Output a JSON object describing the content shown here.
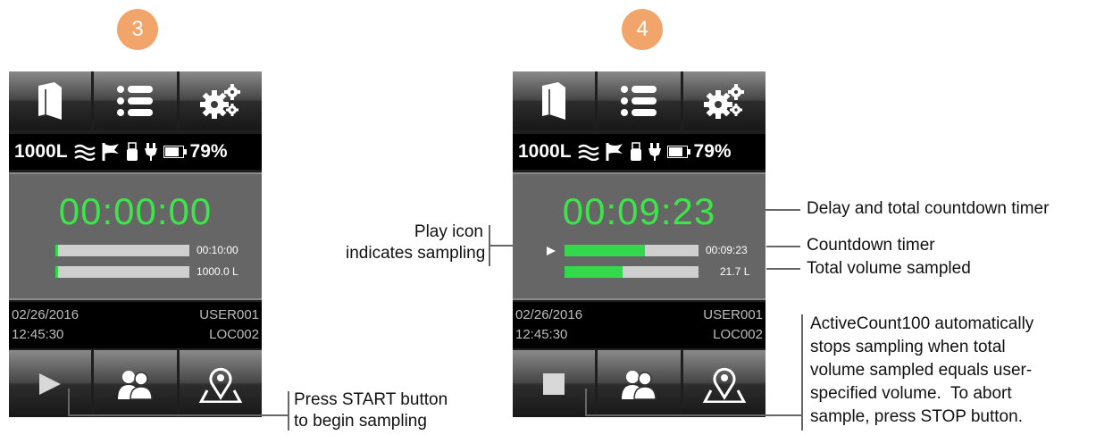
{
  "steps": [
    {
      "number": "3",
      "status": {
        "volume": "1000L",
        "battery": "79%"
      },
      "timer": "00:00:00",
      "bars": [
        {
          "value": "00:10:00",
          "fill": 0.02
        },
        {
          "value": "1000.0 L",
          "fill": 0.02
        }
      ],
      "sampling": false,
      "info": {
        "date": "02/26/2016",
        "time": "12:45:30",
        "user": "USER001",
        "location": "LOC002"
      },
      "start_stop_icon": "play-icon"
    },
    {
      "number": "4",
      "status": {
        "volume": "1000L",
        "battery": "79%"
      },
      "timer": "00:09:23",
      "bars": [
        {
          "value": "00:09:23",
          "fill": 0.6
        },
        {
          "value": "21.7 L",
          "fill": 0.43
        }
      ],
      "sampling": true,
      "info": {
        "date": "02/26/2016",
        "time": "12:45:30",
        "user": "USER001",
        "location": "LOC002"
      },
      "start_stop_icon": "stop-icon"
    }
  ],
  "icons": {
    "top": [
      "book-icon",
      "list-icon",
      "gear-icon"
    ],
    "status": [
      "flow-icon",
      "flag-icon",
      "usb-icon",
      "plug-icon",
      "battery-icon"
    ],
    "bottom": [
      "users-icon",
      "map-pin-icon"
    ]
  },
  "annotations": {
    "press_start": [
      "Press START button",
      "to begin sampling"
    ],
    "play_icon": [
      "Play icon",
      "indicates sampling"
    ],
    "delay_timer": "Delay and total countdown timer",
    "countdown_timer": "Countdown timer",
    "total_volume": "Total volume sampled",
    "auto_stop": [
      "ActiveCount100 automatically",
      "stops sampling when total",
      "volume sampled equals user-",
      "specified volume.  To abort",
      "sample, press STOP button."
    ]
  },
  "colors": {
    "timer_green": "#3ee54a",
    "bar_green": "#33d94a",
    "step_badge": "#f2a56a",
    "panel_gray": "#666666"
  }
}
